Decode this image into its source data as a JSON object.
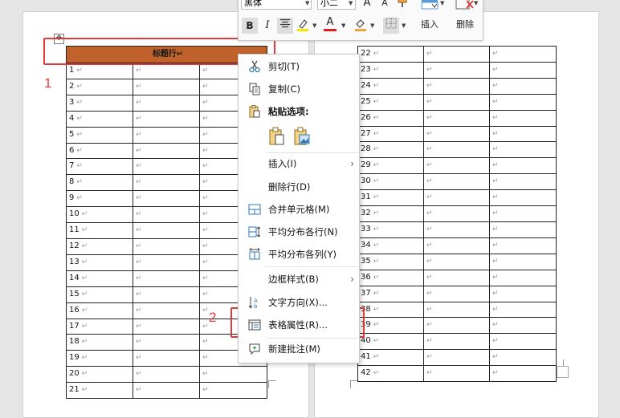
{
  "toolbar": {
    "font_name": "黑体",
    "font_size": "小二",
    "grow_font": "A",
    "shrink_font": "A",
    "bold": "B",
    "italic": "I",
    "font_color_glyph": "A",
    "insert_label": "插入",
    "delete_label": "删除",
    "colors": {
      "highlight": "#f5e400",
      "font": "#e01f1f",
      "shading": "#f0a040"
    }
  },
  "table": {
    "header_text": "标题行",
    "para_mark": "↵",
    "left_rows": [
      "1",
      "2",
      "3",
      "4",
      "5",
      "6",
      "7",
      "8",
      "9",
      "10",
      "11",
      "12",
      "13",
      "14",
      "15",
      "16",
      "17",
      "18",
      "19",
      "20",
      "21"
    ],
    "right_rows": [
      "22",
      "23",
      "24",
      "25",
      "26",
      "27",
      "28",
      "29",
      "30",
      "31",
      "32",
      "33",
      "34",
      "35",
      "36",
      "37",
      "38",
      "39",
      "40",
      "41",
      "42"
    ],
    "header_color": "#c0622c"
  },
  "context_menu": {
    "cut": "剪切(T)",
    "copy": "复制(C)",
    "paste_options": "粘贴选项:",
    "insert": "插入(I)",
    "delete_row": "删除行(D)",
    "merge_cells": "合并单元格(M)",
    "distribute_rows": "平均分布各行(N)",
    "distribute_cols": "平均分布各列(Y)",
    "border_style": "边框样式(B)",
    "text_direction": "文字方向(X)...",
    "table_properties": "表格属性(R)...",
    "new_comment": "新建批注(M)"
  },
  "annotations": {
    "label_1": "1",
    "label_2": "2",
    "color": "#e23a3a"
  }
}
